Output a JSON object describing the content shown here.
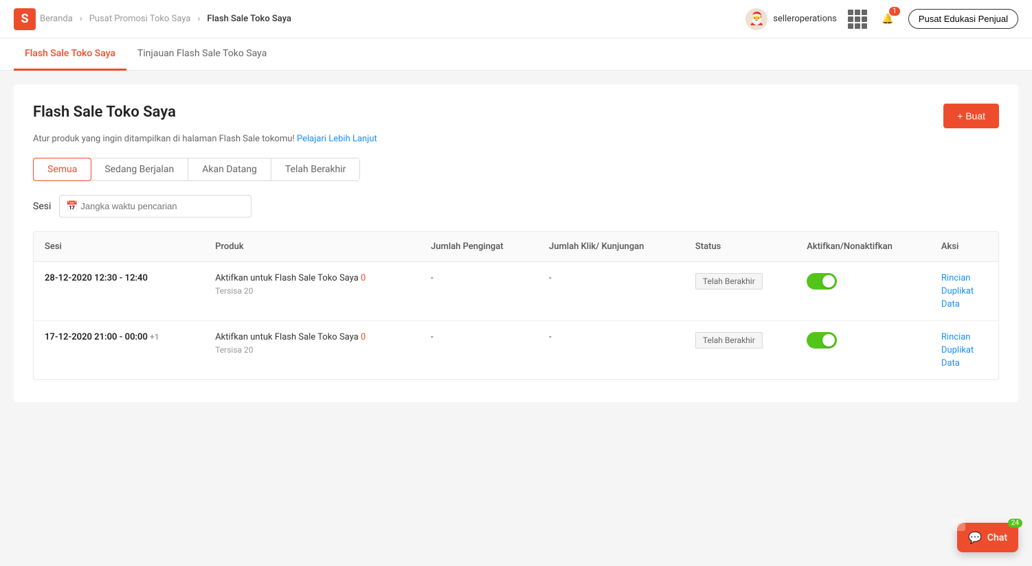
{
  "topnav": {
    "logo_letter": "S",
    "breadcrumbs": [
      {
        "label": "Beranda",
        "link": true
      },
      {
        "label": "Pusat Promosi Toko Saya",
        "link": true
      },
      {
        "label": "Flash Sale Toko Saya",
        "link": false
      }
    ],
    "username": "selleroperations",
    "notif_count": "1",
    "edu_button_label": "Pusat Edukasi Penjual"
  },
  "tabnav": {
    "items": [
      {
        "label": "Flash Sale Toko Saya",
        "active": true
      },
      {
        "label": "Tinjauan Flash Sale Toko Saya",
        "active": false
      }
    ]
  },
  "page": {
    "title": "Flash Sale Toko Saya",
    "subtitle": "Atur produk yang ingin ditampilkan di halaman Flash Sale tokomu!",
    "subtitle_link": "Pelajari Lebih Lanjut",
    "create_button": "+ Buat"
  },
  "filter_tabs": [
    {
      "label": "Semua",
      "active": true
    },
    {
      "label": "Sedang Berjalan",
      "active": false
    },
    {
      "label": "Akan Datang",
      "active": false
    },
    {
      "label": "Telah Berakhir",
      "active": false
    }
  ],
  "search": {
    "label": "Sesi",
    "placeholder": "Jangka waktu pencarian"
  },
  "table": {
    "headers": [
      "Sesi",
      "Produk",
      "Jumlah Pengingat",
      "Jumlah Klik/ Kunjungan",
      "Status",
      "Aktifkan/Nonaktifkan",
      "Aksi"
    ],
    "rows": [
      {
        "session": "28-12-2020 12:30 - 12:40",
        "session_suffix": "",
        "product_text": "Aktifkan untuk Flash Sale Toko Saya",
        "product_count": "0",
        "product_remaining": "Tersisa 20",
        "jumlah_pengingat": "-",
        "jumlah_klik": "-",
        "status": "Telah Berakhir",
        "toggle_on": true,
        "actions": [
          "Rincian",
          "Duplikat",
          "Data"
        ]
      },
      {
        "session": "17-12-2020 21:00 - 00:00",
        "session_suffix": "+1",
        "product_text": "Aktifkan untuk Flash Sale Toko Saya",
        "product_count": "0",
        "product_remaining": "Tersisa 20",
        "jumlah_pengingat": "-",
        "jumlah_klik": "-",
        "status": "Telah Berakhir",
        "toggle_on": true,
        "actions": [
          "Rincian",
          "Duplikat",
          "Data"
        ]
      }
    ]
  },
  "chat": {
    "label": "Chat",
    "badge": "24"
  }
}
